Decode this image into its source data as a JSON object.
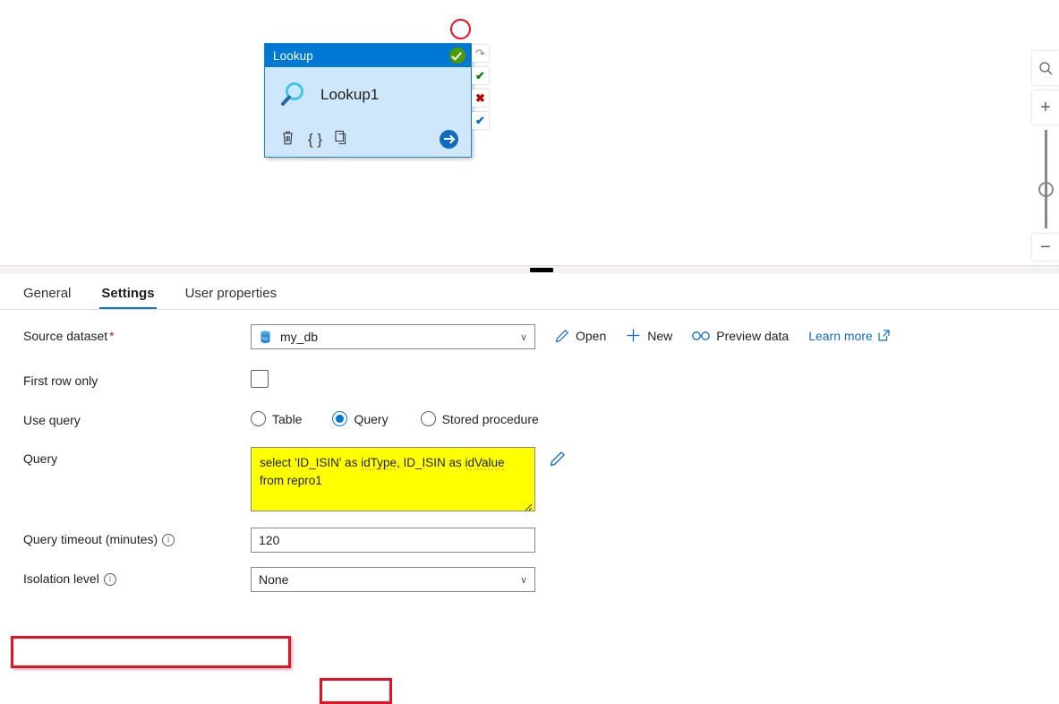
{
  "canvas": {
    "activity": {
      "type_label": "Lookup",
      "name": "Lookup1",
      "status_icon": "green-check-circle-icon",
      "icon": "magnifier-icon",
      "actions": [
        {
          "name": "delete-activity-button",
          "glyph": "🗑"
        },
        {
          "name": "code-view-button",
          "glyph": "{ }"
        },
        {
          "name": "clone-activity-button",
          "glyph": "❐"
        }
      ],
      "next_button": "arrow-right-button"
    },
    "side_buttons": [
      {
        "name": "on-skip-button",
        "glyph": "↷",
        "kind": "gray"
      },
      {
        "name": "on-success-button",
        "glyph": "✔",
        "kind": "g"
      },
      {
        "name": "on-failure-button",
        "glyph": "✖",
        "kind": "r"
      },
      {
        "name": "on-completion-button",
        "glyph": "✔",
        "kind": "b"
      }
    ],
    "zoom_controls": {
      "fit_icon": "zoom-to-fit-icon",
      "zoom_in": "+",
      "zoom_out": "−"
    },
    "annotation_circle": "red-circle-annotation"
  },
  "panel": {
    "tabs": [
      {
        "label": "General",
        "active": false
      },
      {
        "label": "Settings",
        "active": true
      },
      {
        "label": "User properties",
        "active": false
      }
    ],
    "fields": {
      "source_dataset": {
        "label": "Source dataset",
        "required_marker": "*",
        "value": "my_db",
        "icon": "sql-database-icon",
        "chevron": "∨"
      },
      "toolbar": {
        "open": "Open",
        "new": "New",
        "preview": "Preview data",
        "learn_more": "Learn more"
      },
      "first_row_only": {
        "label": "First row only",
        "checked": false
      },
      "use_query": {
        "label": "Use query",
        "options": [
          {
            "label": "Table",
            "selected": false
          },
          {
            "label": "Query",
            "selected": true
          },
          {
            "label": "Stored procedure",
            "selected": false
          }
        ]
      },
      "query": {
        "label": "Query",
        "text_part1": "select 'ID_ISIN' as ",
        "misspelled1": "idType",
        "text_part2": ", ID_ISIN as ",
        "misspelled2": "idValue",
        "text_part3": " from repro1",
        "edit_icon": "pencil-icon"
      },
      "query_timeout": {
        "label": "Query timeout (minutes)",
        "value": "120",
        "info": "ⓘ"
      },
      "isolation_level": {
        "label": "Isolation level",
        "value": "None",
        "info": "ⓘ",
        "chevron": "∨"
      }
    }
  },
  "colors": {
    "accent": "#0078d4",
    "annotation_red": "#e81123",
    "highlight_yellow": "#ffff00",
    "card_body": "#cfe7fa"
  }
}
